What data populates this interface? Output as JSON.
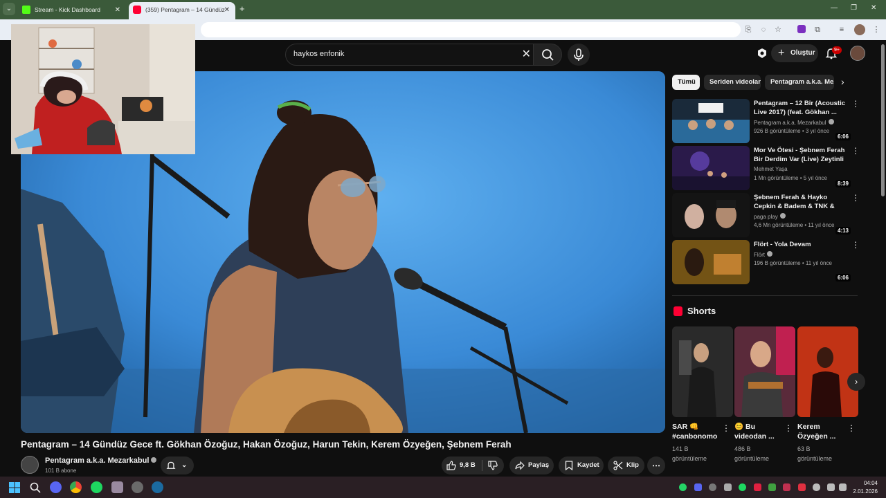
{
  "browser": {
    "tabs": [
      {
        "title": "Stream - Kick Dashboard",
        "active": false,
        "favicon_color": "#53fc18"
      },
      {
        "title": "(359) Pentagram – 14 Gündüz",
        "active": true,
        "favicon_color": "#ff0033"
      }
    ],
    "new_tab": "+",
    "tab_close": "✕",
    "tab_menu": "⌄"
  },
  "header": {
    "search_query": "haykos enfonik",
    "create_label": "Oluştur",
    "notification_count": "9+"
  },
  "video": {
    "title": "Pentagram – 14 Gündüz Gece ft. Gökhan Özoğuz, Hakan Özoğuz, Harun Tekin, Kerem Özyeğen, Şebnem Ferah",
    "channel": "Pentagram a.k.a. Mezarkabul",
    "subscribers": "101 B abone",
    "likes": "9,8 B",
    "share_label": "Paylaş",
    "save_label": "Kaydet",
    "clip_label": "Klip"
  },
  "sidebar": {
    "chips": [
      "Tümü",
      "Seriden videolar",
      "Pentagram a.k.a. Mezarkabul"
    ],
    "recommendations": [
      {
        "title": "Pentagram – 12 Bir (Acoustic Live 2017) (feat. Gökhan ...",
        "channel": "Pentagram a.k.a. Mezarkabul",
        "verified": true,
        "meta": "926 B görüntüleme • 3 yıl önce",
        "duration": "6:06"
      },
      {
        "title": "Mor Ve Ötesi - Şebnem Ferah Bir Derdim Var (Live) Zeytinli ...",
        "channel": "Mehmet Yaşa",
        "verified": false,
        "meta": "1 Mn görüntüleme • 5 yıl önce",
        "duration": "8:39"
      },
      {
        "title": "Şebnem Ferah & Hayko Cepkin & Badem & TNK & Aylin Aslım ...",
        "channel": "paga play",
        "verified": true,
        "meta": "4,6 Mn görüntüleme • 11 yıl önce",
        "duration": "4:13"
      },
      {
        "title": "Flört - Yola Devam",
        "channel": "Flört",
        "verified": true,
        "meta": "196 B görüntüleme • 11 yıl önce",
        "duration": "6:06"
      }
    ],
    "shorts_heading": "Shorts",
    "shorts": [
      {
        "title": "SAR 👊 #canbonomo",
        "views": "141 B görüntüleme"
      },
      {
        "title": "😊 Bu videodan ...",
        "views": "486 B görüntüleme"
      },
      {
        "title": "Kerem Özyeğen ...",
        "views": "63 B görüntüleme"
      }
    ]
  },
  "taskbar": {
    "time": "04:04",
    "date": "2.01.2026"
  },
  "colors": {
    "accent_red": "#ff0033",
    "background": "#0f0f0f",
    "chrome_frame": "#3b5a3a"
  }
}
